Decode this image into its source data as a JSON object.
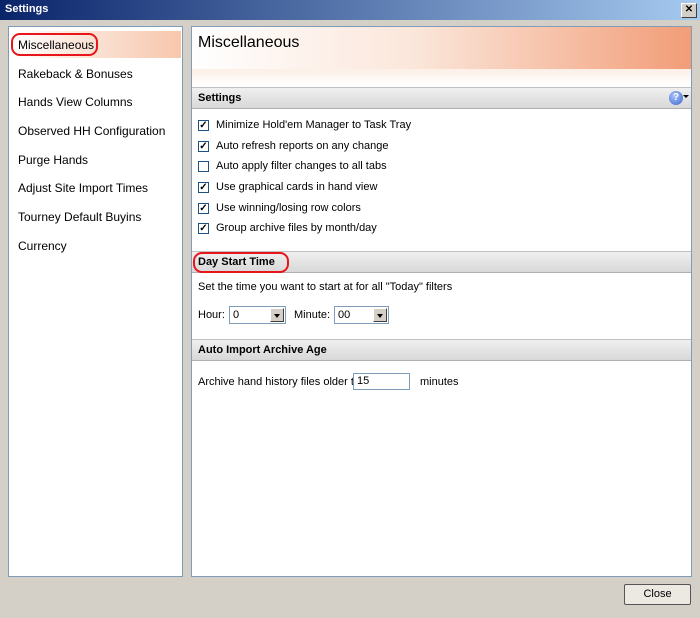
{
  "window": {
    "title": "Settings",
    "close_glyph": "✕"
  },
  "sidebar": {
    "items": [
      {
        "label": "Miscellaneous",
        "selected": true
      },
      {
        "label": "Rakeback & Bonuses"
      },
      {
        "label": "Hands View Columns"
      },
      {
        "label": "Observed HH Configuration"
      },
      {
        "label": "Purge Hands"
      },
      {
        "label": "Adjust Site Import Times"
      },
      {
        "label": "Tourney Default Buyins"
      },
      {
        "label": "Currency"
      }
    ]
  },
  "main": {
    "title": "Miscellaneous",
    "settings": {
      "title": "Settings",
      "help_glyph": "?",
      "options": [
        {
          "label": "Minimize Hold'em Manager to Task Tray",
          "checked": true
        },
        {
          "label": "Auto refresh reports on any change",
          "checked": true
        },
        {
          "label": "Auto apply filter changes to all tabs",
          "checked": false
        },
        {
          "label": "Use graphical cards in hand view",
          "checked": true
        },
        {
          "label": "Use winning/losing row colors",
          "checked": true
        },
        {
          "label": "Group archive files by month/day",
          "checked": true
        }
      ]
    },
    "day_start": {
      "title": "Day Start Time",
      "description": "Set the time you want to start at for all \"Today\" filters",
      "hour_label": "Hour:",
      "hour_value": "0",
      "minute_label": "Minute:",
      "minute_value": "00"
    },
    "auto_import": {
      "title": "Auto Import Archive Age",
      "label": "Archive hand history files older than",
      "value": "15",
      "unit": "minutes"
    }
  },
  "footer": {
    "close_label": "Close"
  },
  "colors": {
    "highlight_circle": "#e8161b",
    "title_bar": "#0a246a"
  },
  "icons": {
    "help": "help-question-icon",
    "dropdown": "chevron-down-icon",
    "check": "checkmark-icon"
  }
}
